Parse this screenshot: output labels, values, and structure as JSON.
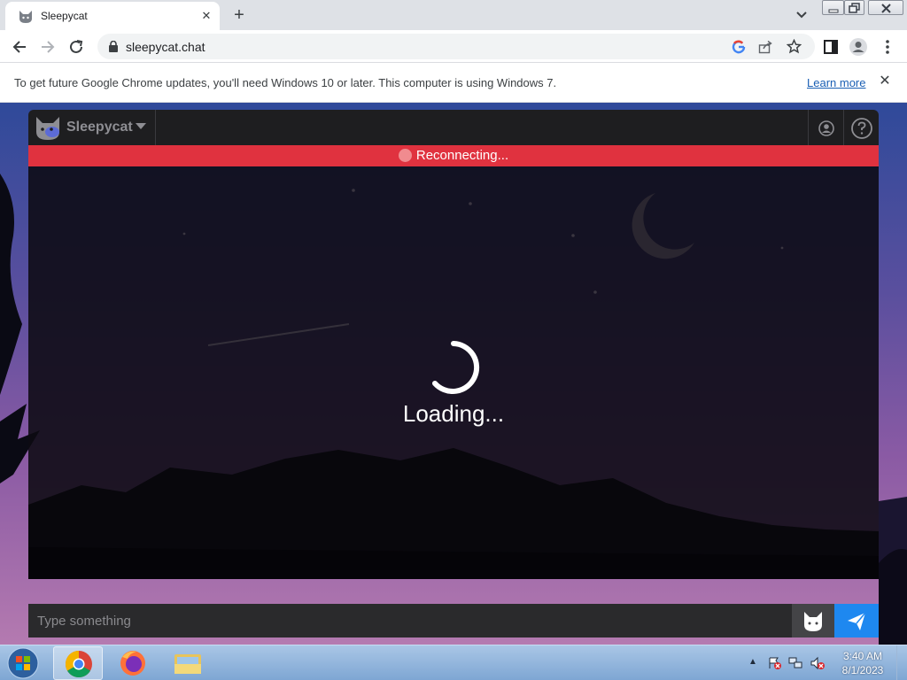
{
  "browser": {
    "tab": {
      "title": "Sleepycat",
      "favicon": "cat-icon",
      "close": "✕"
    },
    "new_tab": "+",
    "url": "sleepycat.chat"
  },
  "infobar": {
    "message": "To get future Google Chrome updates, you'll need Windows 10 or later. This computer is using Windows 7.",
    "link": "Learn more",
    "close": "✕"
  },
  "app": {
    "brand": "Sleepycat",
    "status": {
      "text": "Reconnecting...",
      "color": "#e0323f"
    },
    "loading_text": "Loading...",
    "input": {
      "placeholder": "Type something",
      "value": ""
    },
    "accent": "#1e88f0"
  },
  "taskbar": {
    "pinned": [
      "chrome-icon",
      "firefox-icon",
      "explorer-icon"
    ],
    "tray_arrow": "▲",
    "time": "3:40 AM",
    "date": "8/1/2023"
  }
}
